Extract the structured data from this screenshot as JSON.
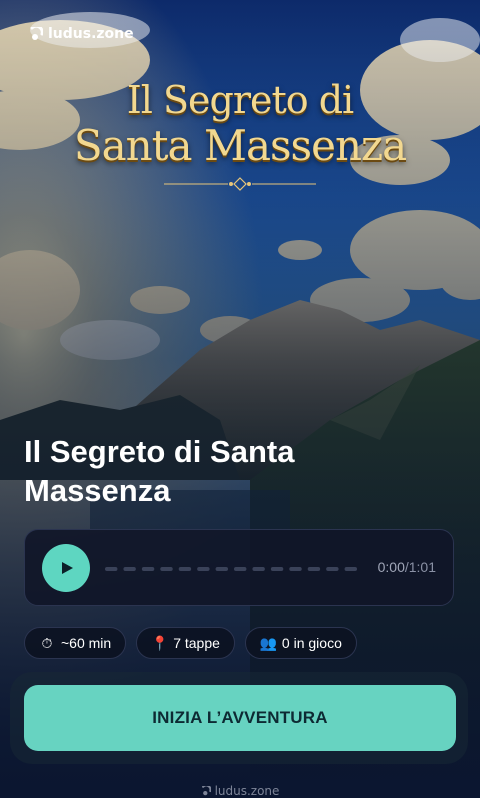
{
  "brand": {
    "name": "ludus.zone",
    "icon": "ludus-logo-icon"
  },
  "hero": {
    "title_line1": "Il Segreto di",
    "title_line2": "Santa Massenza"
  },
  "game": {
    "title": "Il Segreto di Santa Massenza"
  },
  "audio": {
    "current_time": "0:00",
    "separator": "/",
    "duration": "1:01",
    "progress": 0,
    "play_icon": "play-icon"
  },
  "stats": [
    {
      "icon": "stopwatch-icon",
      "emoji": "⏱",
      "label": "~60 min"
    },
    {
      "icon": "pin-icon",
      "emoji": "📍",
      "label": "7 tappe"
    },
    {
      "icon": "people-icon",
      "emoji": "👥",
      "label": "0 in gioco"
    }
  ],
  "cta": {
    "label": "INIZIA L’AVVENTURA"
  },
  "footer": {
    "text": "ludus.zone"
  },
  "colors": {
    "accent": "#5ed6c1",
    "title_gold": "#f2d890",
    "background": "#0b1630"
  }
}
